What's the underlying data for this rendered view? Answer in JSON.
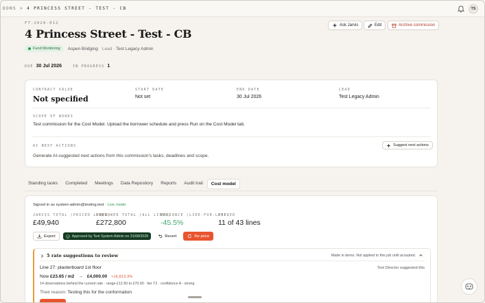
{
  "breadcrumb": {
    "prev": "DONS",
    "sep": ">",
    "current": "4 PRINCESS STREET - TEST - CB"
  },
  "header": {
    "user_initials": "TS"
  },
  "commission": {
    "reference": "FT-2026-012",
    "title": "4 Princess Street - Test - CB",
    "status_badge": "Fund Monitoring",
    "client": "Aspen Bridging",
    "lead_label": "Lead ·",
    "lead_name": "Test Legacy Admin",
    "due_label": "DUE",
    "due_date": "30 Jul 2026",
    "in_progress_label": "IN PROGRESS",
    "in_progress_count": "1"
  },
  "actions": {
    "ask_jarvis": "Ask Jarvis",
    "edit": "Edit",
    "archive": "Archive commission"
  },
  "info": {
    "contract_value_label": "CONTRACT VALUE",
    "contract_value": "Not specified",
    "start_date_label": "START DATE",
    "start_date": "Not set",
    "end_date_label": "END DATE",
    "end_date": "30 Jul 2026",
    "lead_label": "LEAD",
    "lead": "Test Legacy Admin",
    "scope_label": "SCOPE OF WORKS",
    "scope_text": "Test commission for the Cost Model. Upload the borrower schedule and press Run on the Cost Model tab.",
    "ai_label": "AI NEXT ACTIONS",
    "ai_button": "Suggest next actions",
    "ai_text": "Generate AI-suggested next actions from this commission's tasks, deadlines and scope."
  },
  "tabs": [
    {
      "label": "Standing tasks",
      "active": false
    },
    {
      "label": "Completed",
      "active": false
    },
    {
      "label": "Meetings",
      "active": false
    },
    {
      "label": "Data Repository",
      "active": false
    },
    {
      "label": "Reports",
      "active": false
    },
    {
      "label": "Audit trail",
      "active": false
    },
    {
      "label": "Cost model",
      "active": true
    }
  ],
  "cost_model": {
    "signed_in_prefix": "Signed in as",
    "signed_in_user": "system-admin@testing.test",
    "live_mode": "· Live mode",
    "stats": [
      {
        "label": "JARVIS TOTAL (PRICED LINES)",
        "value": "£49,940"
      },
      {
        "label": "BORROWER TOTAL (ALL LINES)",
        "value": "£272,800"
      },
      {
        "label": "VARIANCE (LIKE-FOR-LIKE)",
        "value": "-45.5%"
      },
      {
        "label": "PRICED",
        "value": "11 of 43 lines"
      }
    ],
    "export": "Export",
    "approved": "Approved by Test System Admin on 31/08/2026",
    "revert": "Revert",
    "reprice": "Re-price",
    "suggestions_title": "5 rate suggestions to review",
    "suggestions_note": "Made in demo. Not applied to this job until accepted.",
    "suggestion": {
      "line": "Line 27: plasterboard 1st floor",
      "who": "Test Director suggested this",
      "now_label": "Now",
      "old_rate": "£23.65 / m2",
      "arrow": "→",
      "new_rate": "£4,000.00",
      "change_pct": "+16,813.3%",
      "observations": "14 observations behind the current rate · range £12.50 to £70.00 · tier T2 · confidence A - strong",
      "reason_label": "Their reason:",
      "reason_text": "Testing this for the conformation"
    }
  },
  "colors": {
    "accent": "#e8542f",
    "positive": "#3aa76a",
    "approved_bg": "#163a22",
    "danger": "#b43a2a"
  }
}
